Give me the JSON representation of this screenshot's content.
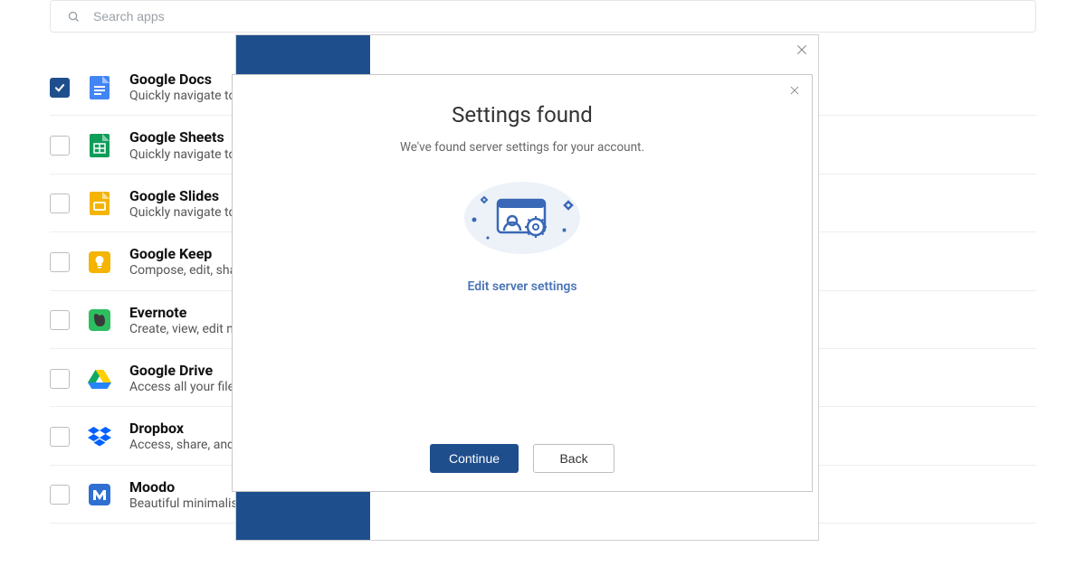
{
  "search": {
    "placeholder": "Search apps"
  },
  "apps": [
    {
      "title": "Google Docs",
      "desc": "Quickly navigate to your favorite docs",
      "checked": true,
      "icon": "gdocs"
    },
    {
      "title": "Google Sheets",
      "desc": "Quickly navigate to your favorite sheets",
      "checked": false,
      "icon": "gsheets"
    },
    {
      "title": "Google Slides",
      "desc": "Quickly navigate to your favorite slides",
      "checked": false,
      "icon": "gslides"
    },
    {
      "title": "Google Keep",
      "desc": "Compose, edit, share your notes",
      "checked": false,
      "icon": "gkeep"
    },
    {
      "title": "Evernote",
      "desc": "Create, view, edit notes",
      "checked": false,
      "icon": "evernote"
    },
    {
      "title": "Google Drive",
      "desc": "Access all your files in one place",
      "checked": false,
      "icon": "gdrive"
    },
    {
      "title": "Dropbox",
      "desc": "Access, share, and organize files",
      "checked": false,
      "icon": "dropbox"
    },
    {
      "title": "Moodo",
      "desc": "Beautiful minimalistic to-do app",
      "checked": false,
      "icon": "moodo"
    }
  ],
  "dialog": {
    "title": "Settings found",
    "subtitle": "We've found server settings for your account.",
    "edit_link": "Edit server settings",
    "continue": "Continue",
    "back": "Back"
  }
}
